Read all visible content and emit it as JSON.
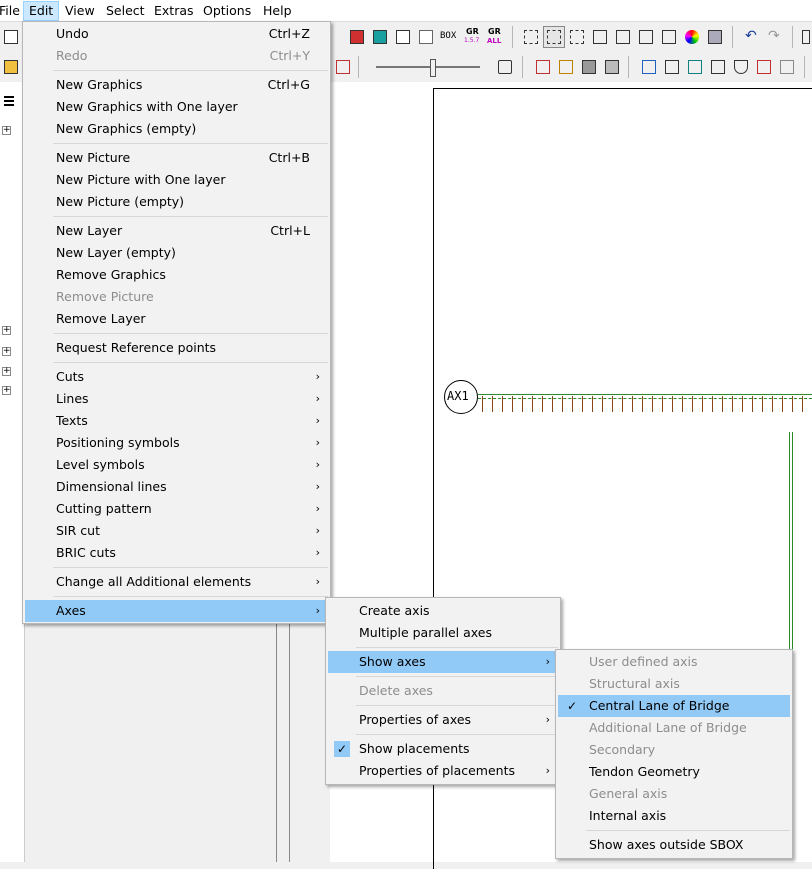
{
  "menubar": {
    "items": [
      "File",
      "Edit",
      "View",
      "Select",
      "Extras",
      "Options",
      "Help"
    ],
    "active": "Edit"
  },
  "toolbar": {
    "box_label": "BOX",
    "gr_label": "GR",
    "gr_sub1": "1.5.7",
    "gr_sub2": "ALL"
  },
  "canvas": {
    "axis_label": "AX1"
  },
  "edit_menu": {
    "items": [
      {
        "label": "Undo",
        "shortcut": "Ctrl+Z"
      },
      {
        "label": "Redo",
        "shortcut": "Ctrl+Y",
        "disabled": true
      },
      {
        "label": "New Graphics",
        "shortcut": "Ctrl+G"
      },
      {
        "label": "New Graphics with One layer"
      },
      {
        "label": "New Graphics (empty)"
      },
      {
        "label": "New Picture",
        "shortcut": "Ctrl+B"
      },
      {
        "label": "New Picture with One layer"
      },
      {
        "label": "New Picture (empty)"
      },
      {
        "label": "New Layer",
        "shortcut": "Ctrl+L"
      },
      {
        "label": "New Layer (empty)"
      },
      {
        "label": "Remove Graphics"
      },
      {
        "label": "Remove Picture",
        "disabled": true
      },
      {
        "label": "Remove Layer"
      },
      {
        "label": "Request Reference points"
      },
      {
        "label": "Cuts",
        "submenu": true
      },
      {
        "label": "Lines",
        "submenu": true
      },
      {
        "label": "Texts",
        "submenu": true
      },
      {
        "label": "Positioning symbols",
        "submenu": true
      },
      {
        "label": "Level symbols",
        "submenu": true
      },
      {
        "label": "Dimensional lines",
        "submenu": true
      },
      {
        "label": "Cutting pattern",
        "submenu": true
      },
      {
        "label": "SIR cut",
        "submenu": true
      },
      {
        "label": "BRIC cuts",
        "submenu": true
      },
      {
        "label": "Change all Additional elements",
        "submenu": true
      },
      {
        "label": "Axes",
        "submenu": true,
        "highlighted": true
      }
    ]
  },
  "axes_menu": {
    "items": [
      {
        "label": "Create axis"
      },
      {
        "label": "Multiple parallel axes"
      },
      {
        "label": "Show axes",
        "submenu": true,
        "highlighted": true
      },
      {
        "label": "Delete axes",
        "disabled": true
      },
      {
        "label": "Properties of axes",
        "submenu": true
      },
      {
        "label": "Show placements",
        "checked": true
      },
      {
        "label": "Properties of placements",
        "submenu": true
      }
    ]
  },
  "show_axes_menu": {
    "items": [
      {
        "label": "User defined axis",
        "disabled": true
      },
      {
        "label": "Structural axis",
        "disabled": true
      },
      {
        "label": "Central Lane of Bridge",
        "checked": true,
        "highlighted": true
      },
      {
        "label": "Additional Lane of Bridge",
        "disabled": true
      },
      {
        "label": "Secondary",
        "disabled": true
      },
      {
        "label": "Tendon Geometry"
      },
      {
        "label": "General axis",
        "disabled": true
      },
      {
        "label": "Internal axis"
      },
      {
        "label": "Show axes outside SBOX"
      }
    ]
  },
  "symbols": {
    "checkmark": "✓",
    "submenu_arrow": "›",
    "tree_plus": "+",
    "undo": "↶",
    "redo": "↷"
  }
}
